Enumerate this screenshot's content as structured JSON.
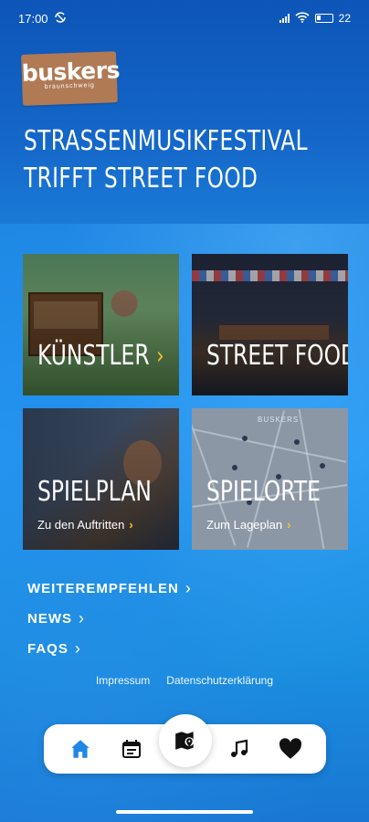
{
  "status_bar": {
    "time": "17:00",
    "battery": "22"
  },
  "logo": {
    "name": "buskers",
    "city": "braunschweig"
  },
  "headline": {
    "line1": "STRASSENMUSIKFESTIVAL",
    "line2": "TRIFFT STREET FOOD"
  },
  "tiles": [
    {
      "title": "KÜNSTLER",
      "subtitle": ""
    },
    {
      "title": "STREET FOOD",
      "subtitle": ""
    },
    {
      "title": "SPIELPLAN",
      "subtitle": "Zu den Auftritten"
    },
    {
      "title": "SPIELORTE",
      "subtitle": "Zum Lageplan",
      "map_label": "BUSKERS"
    }
  ],
  "links": [
    {
      "label": "WEITEREMPFEHLEN"
    },
    {
      "label": "NEWS"
    },
    {
      "label": "FAQS"
    }
  ],
  "legal": {
    "impressum": "Impressum",
    "privacy": "Datenschutzerklärung"
  },
  "nav": {
    "items": [
      "home-icon",
      "calendar-icon",
      "map-icon",
      "music-icon",
      "heart-icon"
    ],
    "active": "home-icon",
    "active_color": "#1e88e5",
    "color": "#111111"
  },
  "colors": {
    "accent_chevron": "#f6c431",
    "background": "#1e88e5",
    "logo": "#b07a55"
  }
}
